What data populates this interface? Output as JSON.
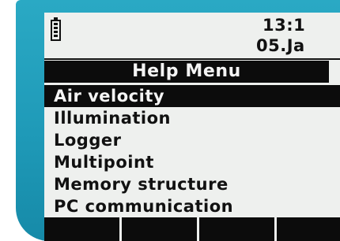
{
  "status": {
    "battery_icon": "battery-icon",
    "time": "13:1",
    "date": "05.Ja"
  },
  "menu": {
    "title": "Help Menu",
    "items": [
      {
        "label": "Air velocity",
        "selected": true
      },
      {
        "label": "Illumination",
        "selected": false
      },
      {
        "label": "Logger",
        "selected": false
      },
      {
        "label": "Multipoint",
        "selected": false
      },
      {
        "label": "Memory structure",
        "selected": false
      },
      {
        "label": "PC communication",
        "selected": false
      }
    ]
  },
  "softkeys": [
    {
      "label": ""
    },
    {
      "label": ""
    },
    {
      "label": ""
    },
    {
      "label": ""
    }
  ],
  "colors": {
    "bezel": "#1f9ab8",
    "screen": "#eef0ee",
    "highlight": "#0c0c0c"
  }
}
